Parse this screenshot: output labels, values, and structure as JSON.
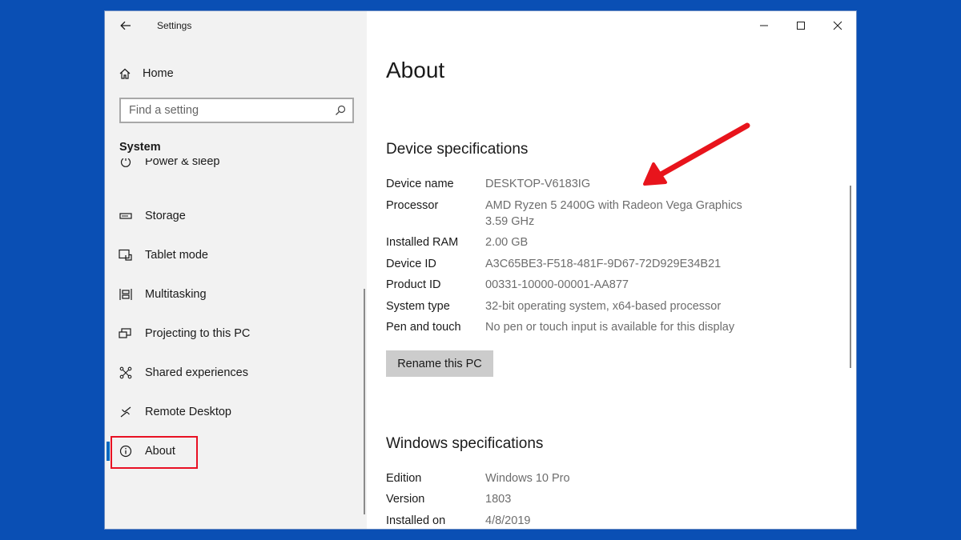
{
  "window": {
    "title": "Settings"
  },
  "sidebar": {
    "home_label": "Home",
    "search_placeholder": "Find a setting",
    "section_label": "System",
    "items": [
      {
        "label": "Power & sleep",
        "icon": "power-icon"
      },
      {
        "label": "Storage",
        "icon": "storage-icon"
      },
      {
        "label": "Tablet mode",
        "icon": "tablet-icon"
      },
      {
        "label": "Multitasking",
        "icon": "multitasking-icon"
      },
      {
        "label": "Projecting to this PC",
        "icon": "projecting-icon"
      },
      {
        "label": "Shared experiences",
        "icon": "shared-icon"
      },
      {
        "label": "Remote Desktop",
        "icon": "remote-desktop-icon"
      },
      {
        "label": "About",
        "icon": "info-icon",
        "active": true
      }
    ]
  },
  "content": {
    "title": "About",
    "device_heading": "Device specifications",
    "device_specs": [
      {
        "key": "Device name",
        "value": "DESKTOP-V6183IG"
      },
      {
        "key": "Processor",
        "value": "AMD Ryzen 5 2400G with Radeon Vega Graphics",
        "value2": "3.59 GHz"
      },
      {
        "key": "Installed RAM",
        "value": "2.00 GB"
      },
      {
        "key": "Device ID",
        "value": "A3C65BE3-F518-481F-9D67-72D929E34B21"
      },
      {
        "key": "Product ID",
        "value": "00331-10000-00001-AA877"
      },
      {
        "key": "System type",
        "value": "32-bit operating system, x64-based processor"
      },
      {
        "key": "Pen and touch",
        "value": "No pen or touch input is available for this display"
      }
    ],
    "rename_button": "Rename this PC",
    "windows_heading": "Windows specifications",
    "windows_specs": [
      {
        "key": "Edition",
        "value": "Windows 10 Pro"
      },
      {
        "key": "Version",
        "value": "1803"
      },
      {
        "key": "Installed on",
        "value": "4/8/2019"
      }
    ]
  },
  "colors": {
    "background": "#0a4fb4",
    "accent": "#0067c0",
    "highlight": "#e81123",
    "annotation_arrow": "#e8141c"
  }
}
